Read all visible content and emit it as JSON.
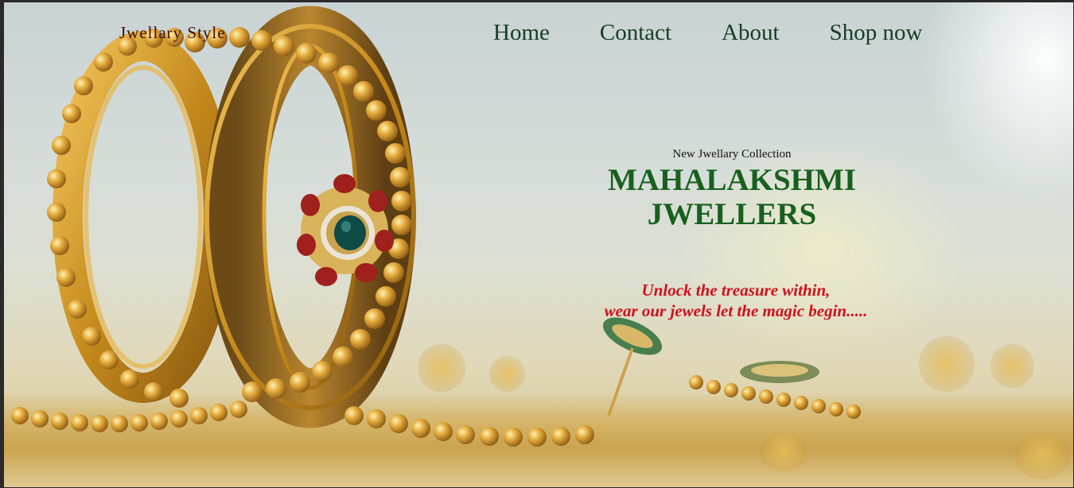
{
  "nav": {
    "logo": "Jwellary Style",
    "items": [
      {
        "label": "Home"
      },
      {
        "label": "Contact"
      },
      {
        "label": "About"
      },
      {
        "label": "Shop now"
      }
    ]
  },
  "hero": {
    "subtitle": "New Jwellary Collection",
    "brand_line1": "MAHALAKSHMI",
    "brand_line2": "JWELLERS",
    "tagline_line1": "Unlock the treasure within,",
    "tagline_line2": "wear our jewels let the magic begin....."
  },
  "colors": {
    "nav_text": "#173d24",
    "brand": "#17601e",
    "tagline": "#d0101c",
    "gold": "#d4a53a"
  },
  "background_image": "gold-bangle-with-gem-and-chain-photo"
}
